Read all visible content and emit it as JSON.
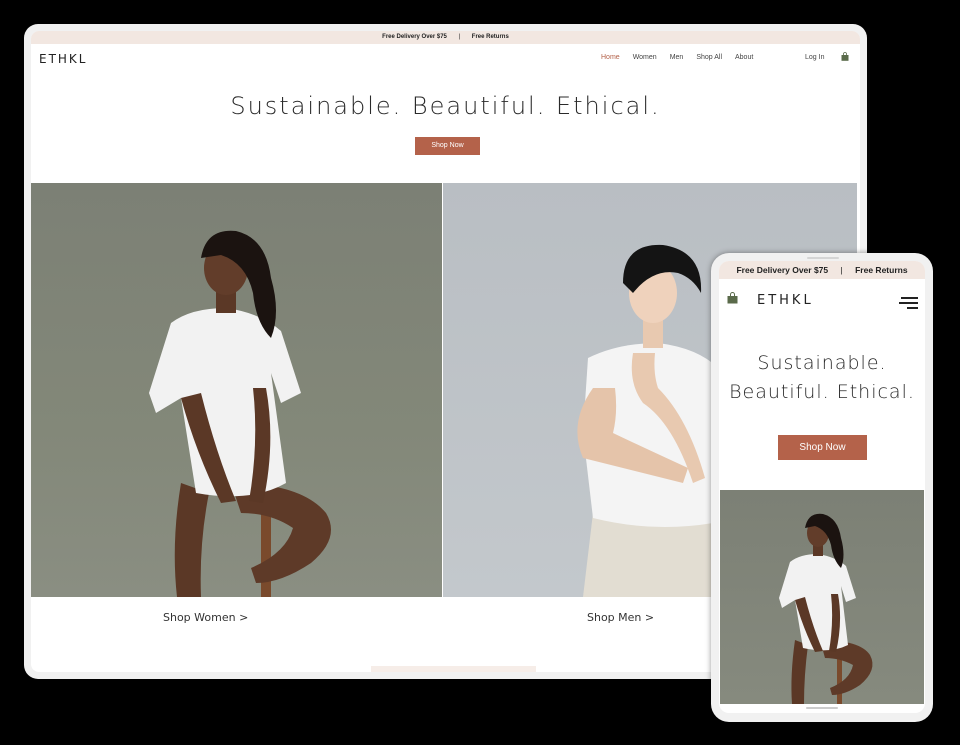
{
  "desktop": {
    "announcement": {
      "left": "Free Delivery Over $75",
      "separator": "|",
      "right": "Free Returns"
    },
    "logo": "ETHKL",
    "nav": [
      {
        "label": "Home",
        "active": true
      },
      {
        "label": "Women",
        "active": false
      },
      {
        "label": "Men",
        "active": false
      },
      {
        "label": "Shop All",
        "active": false
      },
      {
        "label": "About",
        "active": false
      }
    ],
    "login": "Log In",
    "hero_title": "Sustainable. Beautiful. Ethical.",
    "shop_button": "Shop Now",
    "captions": {
      "women": "Shop Women >",
      "men": "Shop Men >"
    },
    "icons": {
      "cart": "shopping-bag-icon"
    }
  },
  "mobile": {
    "announcement": {
      "left": "Free Delivery Over $75",
      "separator": "|",
      "right": "Free Returns"
    },
    "logo": "ETHKL",
    "hero_title_line1": "Sustainable.",
    "hero_title_line2": "Beautiful. Ethical.",
    "shop_button": "Shop Now",
    "icons": {
      "cart": "shopping-bag-icon",
      "menu": "hamburger-menu-icon"
    }
  },
  "colors": {
    "accent": "#b4624a",
    "announcement_bg": "#f2e7e1",
    "women_panel_bg": "#7f8377",
    "men_panel_bg": "#bec3c7"
  }
}
